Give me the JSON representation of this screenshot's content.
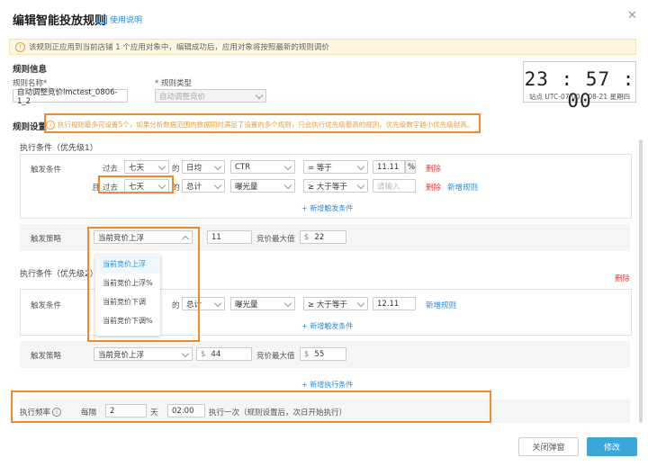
{
  "header": {
    "title": "编辑智能投放规则",
    "help_label": "使用说明",
    "close_symbol": "✕"
  },
  "notice": "该规则正应用到当前店铺 1 个应用对象中，编辑成功后，应用对象将按照最新的规则调价",
  "rule_info": {
    "section_title": "规则信息",
    "name_label": "规则名称*",
    "name_value": "自动调整竞价lmctest_0806-1_2",
    "type_label": "* 规则类型",
    "type_value": "自动调整竞价"
  },
  "clock": {
    "time": "23 : 57 : 00",
    "timezone": "站点 UTC-07:00",
    "date": "08-21 星期四"
  },
  "rule_settings": {
    "section_title": "规则设置",
    "hint": "执行规则最多可设置5个，如果分析数据范围的数据同时满足了设置的多个规则，只会执行优先级最高的规则，优先级数字越小优先级越高。"
  },
  "cond1": {
    "title": "执行条件（优先级1）",
    "trigger_label": "触发条件",
    "row1": {
      "past": "过去",
      "days": "七天",
      "of": "的",
      "agg": "日均",
      "metric": "CTR",
      "op": "= 等于",
      "value": "11.11",
      "unit": "%",
      "delete": "删除"
    },
    "row2": {
      "and": "且",
      "past": "过去",
      "days": "七天",
      "of": "的",
      "agg": "总计",
      "metric": "曝光量",
      "op": "≥ 大于等于",
      "placeholder": "请输入",
      "delete": "删除",
      "add_rule": "新增规则"
    },
    "add_trigger": "+ 新增触发条件",
    "strategy_label": "触发策略",
    "strategy_value": "当前竞价上浮",
    "adjust_value": "11",
    "max_bid_label": "竞价最大值",
    "currency": "$",
    "max_bid_value": "22"
  },
  "dropdown": {
    "options": [
      "当前竞价上浮",
      "当前竞价上浮%",
      "当前竞价下调",
      "当前竞价下调%"
    ]
  },
  "cond2": {
    "title": "执行条件（优先级2）",
    "delete": "删除",
    "trigger_label": "触发条件",
    "row1": {
      "of": "的",
      "agg": "总计",
      "metric": "曝光量",
      "op": "≥ 大于等于",
      "value": "12.11",
      "add_rule": "新增规则"
    },
    "add_trigger": "+ 新增触发条件",
    "strategy_label": "触发策略",
    "strategy_value": "当前竞价上浮",
    "currency": "$",
    "adjust_value": "44",
    "max_bid_label": "竞价最大值",
    "max_bid_value": "55"
  },
  "add_exec": "+ 新增执行条件",
  "frequency": {
    "label": "执行频率",
    "every": "每隔",
    "interval": "2",
    "day_unit": "天",
    "time": "02:00",
    "desc": "执行一次（规则设置后，次日开始执行）"
  },
  "footer": {
    "close_label": "关闭弹窗",
    "submit_label": "修改"
  },
  "colors": {
    "accent": "#2a8ed8",
    "primary_button": "#3ba7d8",
    "danger": "#e04040",
    "highlight": "#ef8a2e"
  }
}
